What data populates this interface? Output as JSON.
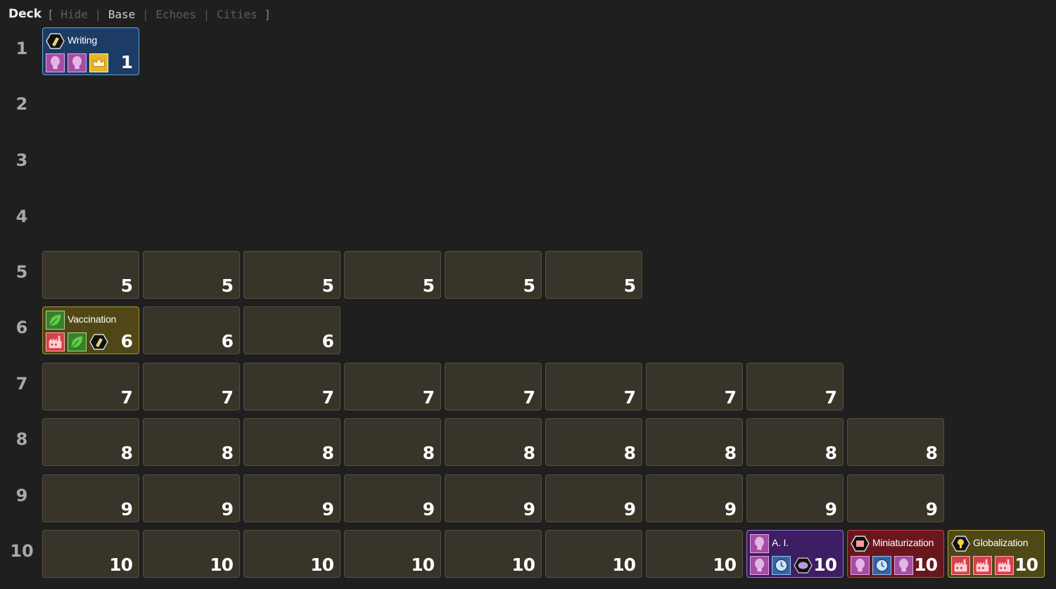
{
  "header": {
    "title": "Deck",
    "open_bracket": "[",
    "close_bracket": "]",
    "separator": "|",
    "options": [
      "Hide",
      "Base",
      "Echoes",
      "Cities"
    ],
    "active_option": "Base"
  },
  "age_labels": [
    "1",
    "2",
    "3",
    "4",
    "5",
    "6",
    "7",
    "8",
    "9",
    "10"
  ],
  "rows": [
    {
      "age": "1",
      "cards": [
        {
          "face": true,
          "name": "Writing",
          "color": "blue",
          "age": "1",
          "top_icon": "lightbulb-hex-icon",
          "icons": [
            "lightbulb-icon",
            "lightbulb-icon",
            "crown-icon"
          ]
        }
      ]
    },
    {
      "age": "2",
      "cards": []
    },
    {
      "age": "3",
      "cards": []
    },
    {
      "age": "4",
      "cards": []
    },
    {
      "age": "5",
      "cards": [
        {
          "face": false,
          "age": "5"
        },
        {
          "face": false,
          "age": "5"
        },
        {
          "face": false,
          "age": "5"
        },
        {
          "face": false,
          "age": "5"
        },
        {
          "face": false,
          "age": "5"
        },
        {
          "face": false,
          "age": "5"
        }
      ]
    },
    {
      "age": "6",
      "cards": [
        {
          "face": true,
          "name": "Vaccination",
          "color": "green",
          "age": "6",
          "top_icon": "leaf-icon",
          "icons": [
            "factory-icon",
            "leaf-icon",
            "lightbulb-hex-icon"
          ]
        },
        {
          "face": false,
          "age": "6"
        },
        {
          "face": false,
          "age": "6"
        }
      ]
    },
    {
      "age": "7",
      "cards": [
        {
          "face": false,
          "age": "7"
        },
        {
          "face": false,
          "age": "7"
        },
        {
          "face": false,
          "age": "7"
        },
        {
          "face": false,
          "age": "7"
        },
        {
          "face": false,
          "age": "7"
        },
        {
          "face": false,
          "age": "7"
        },
        {
          "face": false,
          "age": "7"
        },
        {
          "face": false,
          "age": "7"
        }
      ]
    },
    {
      "age": "8",
      "cards": [
        {
          "face": false,
          "age": "8"
        },
        {
          "face": false,
          "age": "8"
        },
        {
          "face": false,
          "age": "8"
        },
        {
          "face": false,
          "age": "8"
        },
        {
          "face": false,
          "age": "8"
        },
        {
          "face": false,
          "age": "8"
        },
        {
          "face": false,
          "age": "8"
        },
        {
          "face": false,
          "age": "8"
        },
        {
          "face": false,
          "age": "8"
        }
      ]
    },
    {
      "age": "9",
      "cards": [
        {
          "face": false,
          "age": "9"
        },
        {
          "face": false,
          "age": "9"
        },
        {
          "face": false,
          "age": "9"
        },
        {
          "face": false,
          "age": "9"
        },
        {
          "face": false,
          "age": "9"
        },
        {
          "face": false,
          "age": "9"
        },
        {
          "face": false,
          "age": "9"
        },
        {
          "face": false,
          "age": "9"
        },
        {
          "face": false,
          "age": "9"
        }
      ]
    },
    {
      "age": "10",
      "cards": [
        {
          "face": false,
          "age": "10"
        },
        {
          "face": false,
          "age": "10"
        },
        {
          "face": false,
          "age": "10"
        },
        {
          "face": false,
          "age": "10"
        },
        {
          "face": false,
          "age": "10"
        },
        {
          "face": false,
          "age": "10"
        },
        {
          "face": false,
          "age": "10"
        },
        {
          "face": true,
          "name": "A. I.",
          "color": "purple",
          "age": "10",
          "top_icon": "lightbulb-icon",
          "icons": [
            "lightbulb-icon",
            "clock-icon",
            "brain-hex-icon"
          ]
        },
        {
          "face": true,
          "name": "Miniaturization",
          "color": "red",
          "age": "10",
          "top_icon": "factory-hex-icon",
          "icons": [
            "lightbulb-icon",
            "clock-icon",
            "lightbulb-icon"
          ]
        },
        {
          "face": true,
          "name": "Globalization",
          "color": "yellow",
          "age": "10",
          "top_icon": "crown-hex-icon",
          "icons": [
            "factory-icon",
            "factory-icon",
            "factory-icon"
          ]
        }
      ]
    }
  ],
  "colors": {
    "background": "#1f1f1f",
    "card_back": "#38342a",
    "blue": "#1c3c66",
    "green": "#514716",
    "purple": "#3d1d63",
    "red": "#69171d",
    "yellow": "#4e4716"
  }
}
